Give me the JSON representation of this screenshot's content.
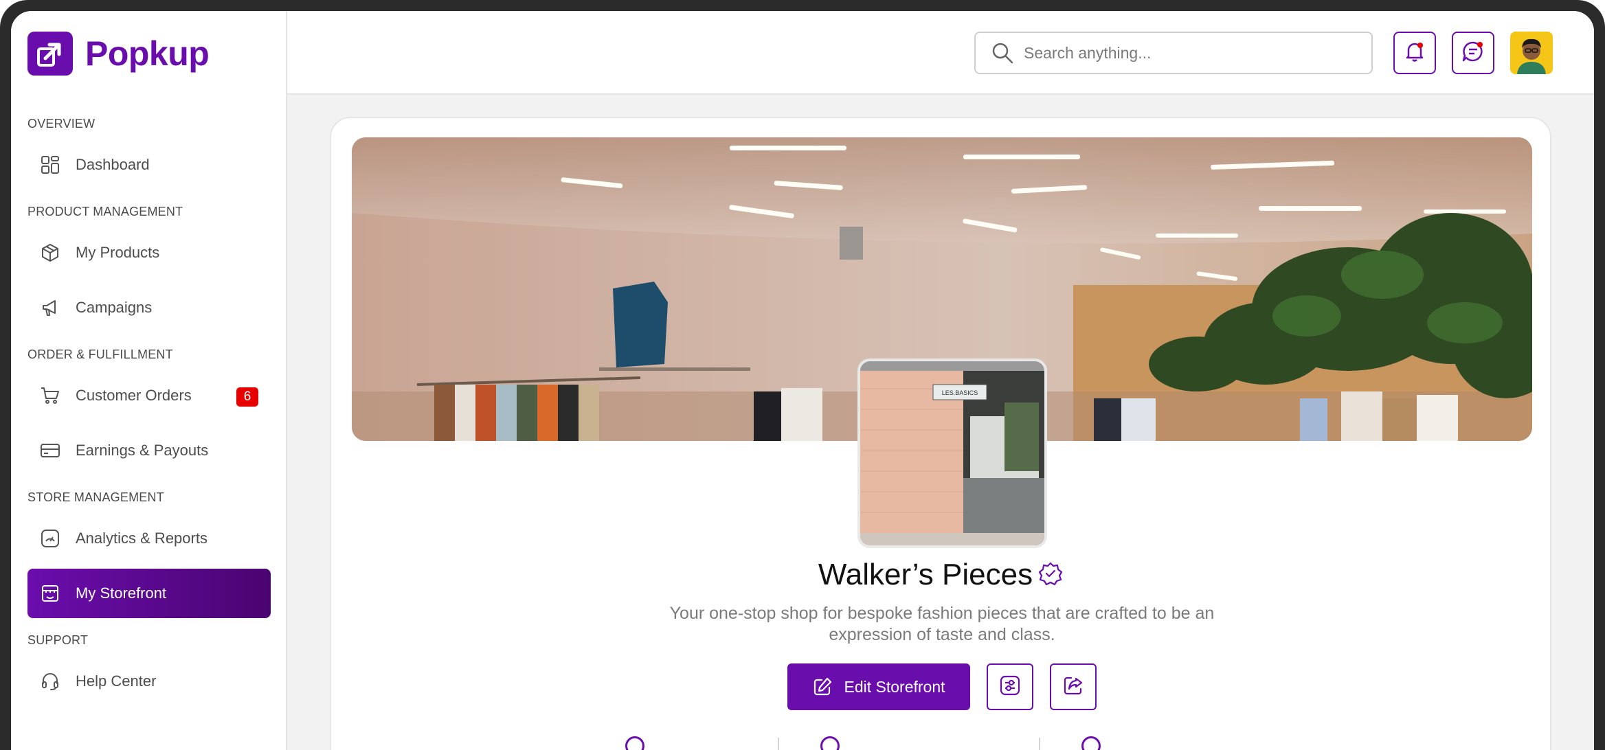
{
  "brand": {
    "name": "Popkup",
    "color": "#6a0dad"
  },
  "search": {
    "placeholder": "Search anything..."
  },
  "topbar": {
    "icons": [
      "bell-icon",
      "chat-icon",
      "user-avatar"
    ]
  },
  "sidebar": {
    "sections": [
      {
        "label": "OVERVIEW",
        "items": [
          {
            "label": "Dashboard",
            "icon": "dashboard-icon"
          }
        ]
      },
      {
        "label": "PRODUCT MANAGEMENT",
        "items": [
          {
            "label": "My Products",
            "icon": "box-icon"
          },
          {
            "label": "Campaigns",
            "icon": "megaphone-icon"
          }
        ]
      },
      {
        "label": "ORDER & FULFILLMENT",
        "items": [
          {
            "label": "Customer Orders",
            "icon": "cart-icon",
            "badge": "6"
          },
          {
            "label": "Earnings & Payouts",
            "icon": "card-icon"
          }
        ]
      },
      {
        "label": "STORE MANAGEMENT",
        "items": [
          {
            "label": "Analytics & Reports",
            "icon": "gauge-icon"
          },
          {
            "label": "My Storefront",
            "icon": "storefront-icon",
            "active": true
          }
        ]
      },
      {
        "label": "SUPPORT",
        "items": [
          {
            "label": "Help Center",
            "icon": "headset-icon"
          }
        ]
      }
    ]
  },
  "storefront": {
    "name": "Walker’s Pieces",
    "description": "Your one-stop shop for bespoke fashion pieces that are crafted to be an expression of taste and class.",
    "edit_label": "Edit Storefront",
    "thumb_sign": "LES.BASICS"
  },
  "colors": {
    "accent": "#6a0dad",
    "badge": "#e60000"
  }
}
